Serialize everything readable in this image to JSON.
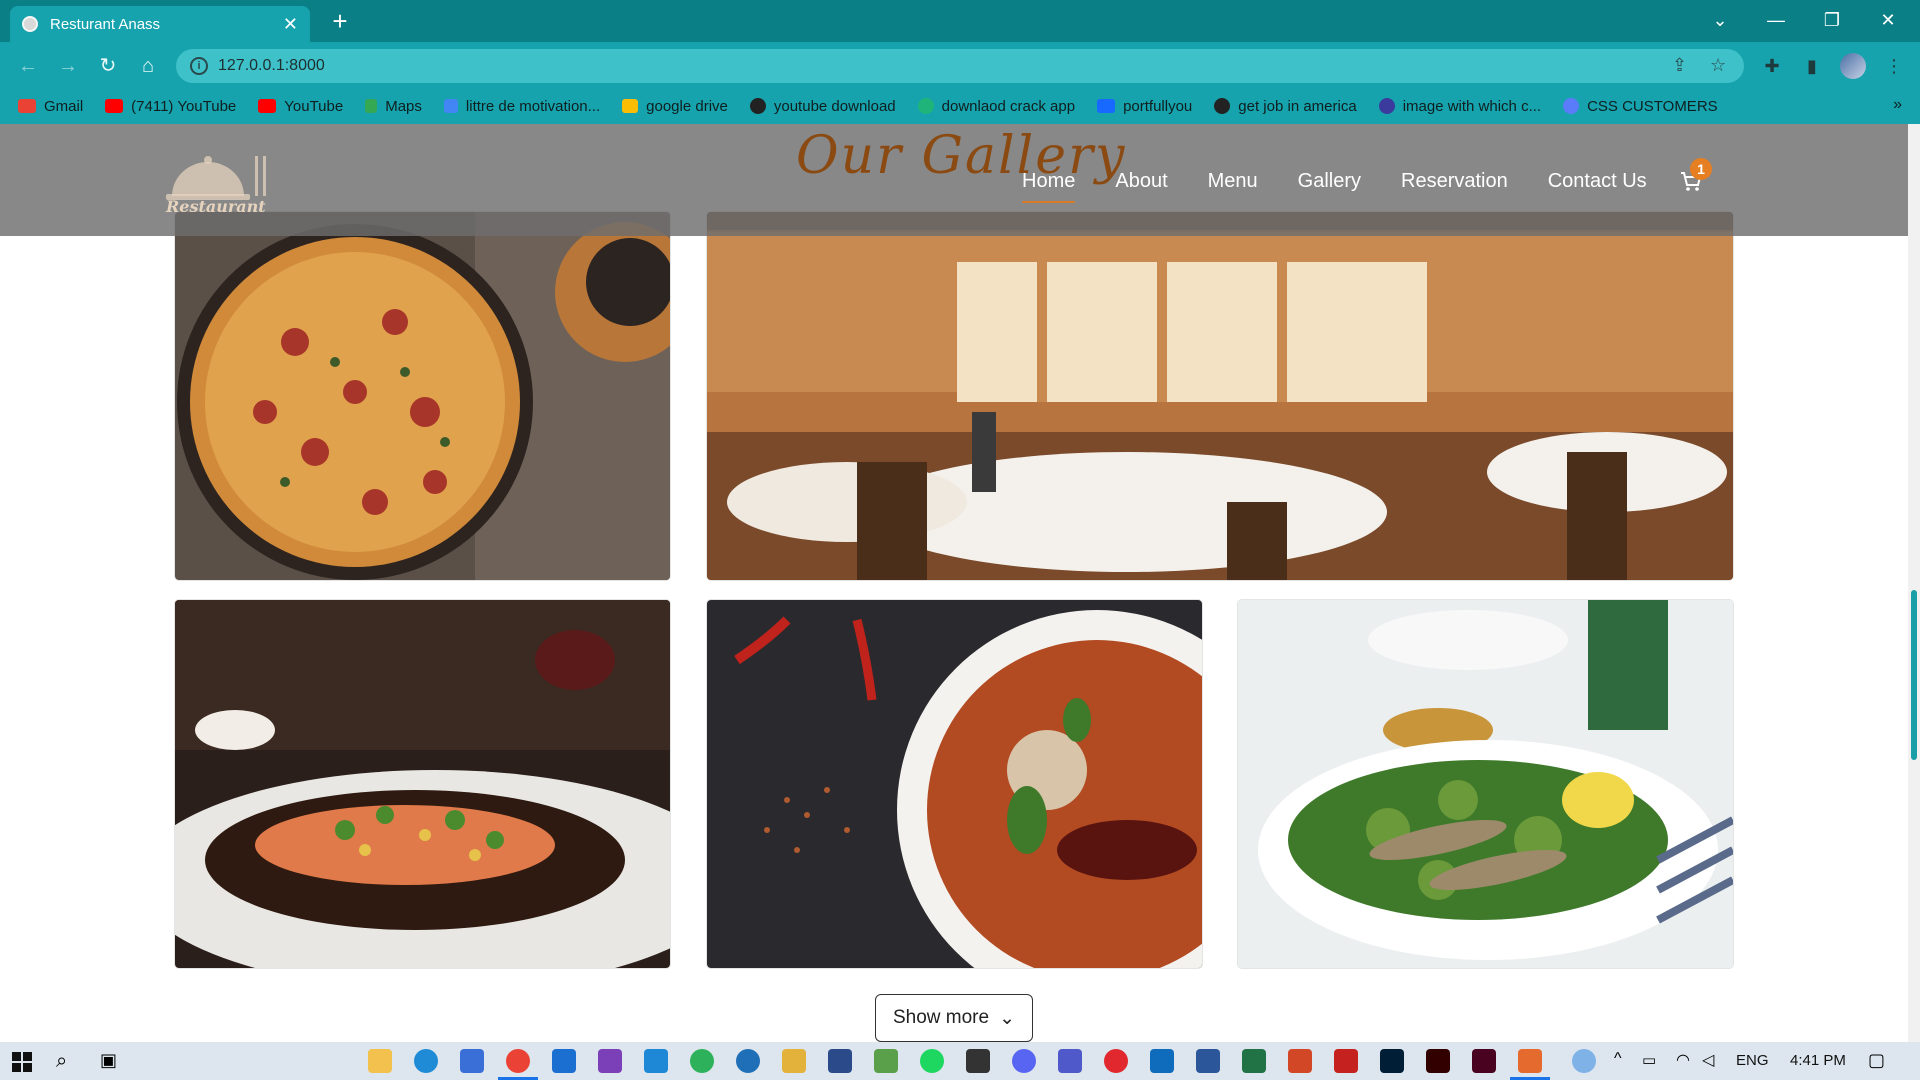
{
  "browser": {
    "tab_title": "Resturant Anass",
    "url": "127.0.0.1:8000",
    "bookmarks": [
      {
        "label": "Gmail",
        "color": "#ea4335"
      },
      {
        "label": "(7411) YouTube",
        "color": "#ff0000"
      },
      {
        "label": "YouTube",
        "color": "#ff0000"
      },
      {
        "label": "Maps",
        "color": "#34a853"
      },
      {
        "label": "littre de motivation...",
        "color": "#4285f4"
      },
      {
        "label": "google drive",
        "color": "#fbbc04"
      },
      {
        "label": "youtube download",
        "color": "#222222"
      },
      {
        "label": "downlaod crack app",
        "color": "#1fb57a"
      },
      {
        "label": "portfullyou",
        "color": "#1769ff"
      },
      {
        "label": "get job in america",
        "color": "#222222"
      },
      {
        "label": "image with which c...",
        "color": "#3b3b9e"
      },
      {
        "label": "CSS CUSTOMERS",
        "color": "#5b7cfa"
      }
    ]
  },
  "site": {
    "section_title": "Our Gallery",
    "logo_text": "Restaurant",
    "nav": [
      "Home",
      "About",
      "Menu",
      "Gallery",
      "Reservation",
      "Contact Us"
    ],
    "cart_count": "1",
    "show_more_label": "Show more",
    "accent_color": "#e67e22",
    "gallery_images": [
      "pizza",
      "restaurant-dining-room",
      "salmon-dish",
      "curry-bowl",
      "salad-with-fish"
    ]
  },
  "taskbar": {
    "language": "ENG",
    "time": "4:41 PM"
  }
}
